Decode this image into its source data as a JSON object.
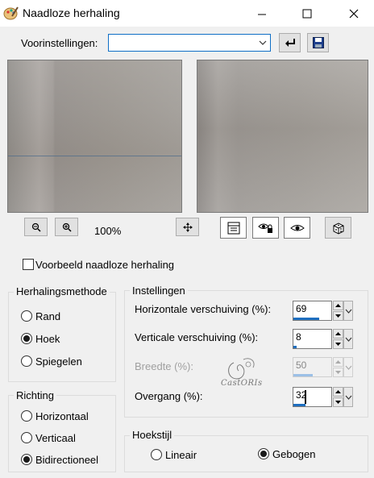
{
  "window": {
    "title": "Naadloze herhaling"
  },
  "presets": {
    "label": "Voorinstellingen:",
    "value": ""
  },
  "zoom": {
    "level": "100%"
  },
  "checkbox": {
    "label": "Voorbeeld naadloze herhaling",
    "checked": false
  },
  "method": {
    "title": "Herhalingsmethode",
    "options": [
      "Rand",
      "Hoek",
      "Spiegelen"
    ],
    "selected": "Hoek"
  },
  "direction": {
    "title": "Richting",
    "options": [
      "Horizontaal",
      "Verticaal",
      "Bidirectioneel"
    ],
    "selected": "Bidirectioneel"
  },
  "settings": {
    "title": "Instellingen",
    "fields": [
      {
        "label": "Horizontale verschuiving (%):",
        "value": "69",
        "enabled": true,
        "level": 0.69
      },
      {
        "label": "Verticale verschuiving (%):",
        "value": "8",
        "enabled": true,
        "level": 0.08
      },
      {
        "label": "Breedte (%):",
        "value": "50",
        "enabled": false,
        "level": 0.5
      },
      {
        "label": "Overgang (%):",
        "value": "32",
        "enabled": true,
        "level": 0.32
      }
    ]
  },
  "corner": {
    "title": "Hoekstijl",
    "options": [
      "Lineair",
      "Gebogen"
    ],
    "selected": "Gebogen"
  },
  "watermark": {
    "text": "CastORIs"
  },
  "colors": {
    "accent": "#0f6fc6",
    "bar": "#1f6fc0"
  }
}
